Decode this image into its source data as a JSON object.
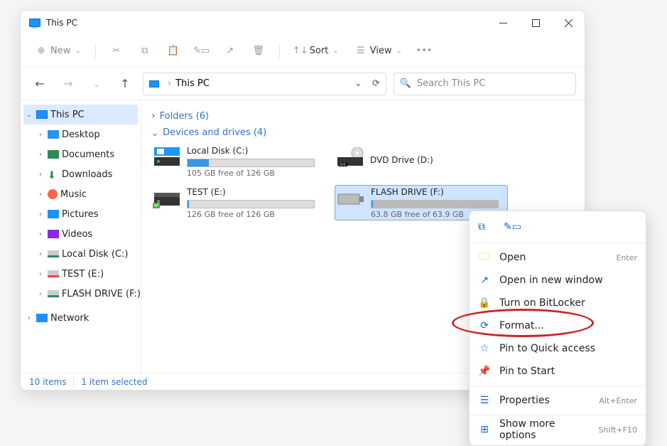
{
  "window": {
    "title": "This PC"
  },
  "toolbar": {
    "new_label": "New",
    "sort_label": "Sort",
    "view_label": "View"
  },
  "breadcrumb": {
    "root": "This PC"
  },
  "search": {
    "placeholder": "Search This PC"
  },
  "sidebar": {
    "items": [
      {
        "label": "This PC",
        "icon": "pc",
        "level": 0,
        "expanded": true,
        "selected": true
      },
      {
        "label": "Desktop",
        "icon": "desktop",
        "level": 1
      },
      {
        "label": "Documents",
        "icon": "doc",
        "level": 1
      },
      {
        "label": "Downloads",
        "icon": "down",
        "level": 1
      },
      {
        "label": "Music",
        "icon": "music",
        "level": 1
      },
      {
        "label": "Pictures",
        "icon": "pic",
        "level": 1
      },
      {
        "label": "Videos",
        "icon": "vid",
        "level": 1
      },
      {
        "label": "Local Disk (C:)",
        "icon": "disk",
        "level": 1
      },
      {
        "label": "TEST (E:)",
        "icon": "fd",
        "level": 1
      },
      {
        "label": "FLASH DRIVE (F:)",
        "icon": "disk",
        "level": 1
      },
      {
        "label": "Network",
        "icon": "net",
        "level": 0
      }
    ]
  },
  "groups": {
    "folders": "Folders (6)",
    "devices": "Devices and drives (4)"
  },
  "drives": [
    {
      "name": "Local Disk (C:)",
      "free": "105 GB free of 126 GB",
      "fill_pct": 17,
      "type": "hdd"
    },
    {
      "name": "DVD Drive (D:)",
      "free": "",
      "fill_pct": null,
      "type": "dvd"
    },
    {
      "name": "TEST (E:)",
      "free": "126 GB free of 126 GB",
      "fill_pct": 1,
      "type": "hdd"
    },
    {
      "name": "FLASH DRIVE (F:)",
      "free": "63.8 GB free of 63.9 GB",
      "fill_pct": 1,
      "type": "usb",
      "selected": true
    }
  ],
  "status": {
    "items": "10 items",
    "selected": "1 item selected"
  },
  "context_menu": {
    "items": [
      {
        "label": "Open",
        "icon": "folder",
        "shortcut": "Enter"
      },
      {
        "label": "Open in new window",
        "icon": "external"
      },
      {
        "label": "Turn on BitLocker",
        "icon": "lock"
      },
      {
        "label": "Format...",
        "icon": "format"
      },
      {
        "label": "Pin to Quick access",
        "icon": "star"
      },
      {
        "label": "Pin to Start",
        "icon": "pin"
      },
      {
        "label": "Properties",
        "icon": "props",
        "shortcut": "Alt+Enter"
      },
      {
        "label": "Show more options",
        "icon": "more",
        "shortcut": "Shift+F10"
      }
    ]
  }
}
